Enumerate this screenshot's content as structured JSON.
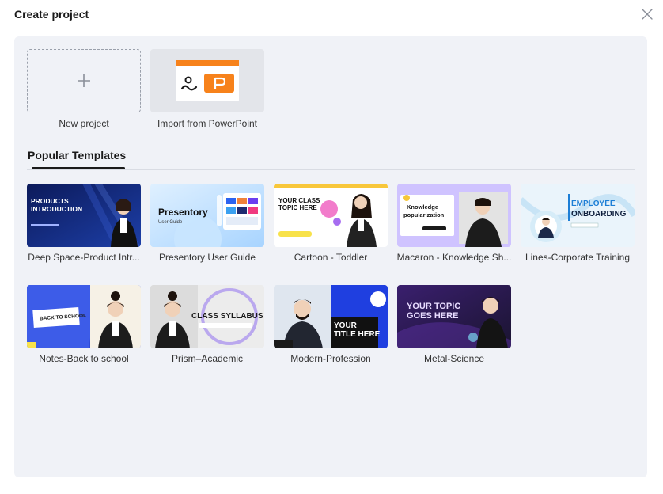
{
  "dialog": {
    "title": "Create project",
    "close_icon": "close-icon"
  },
  "actions": {
    "new_project": "New project",
    "import_ppt": "Import from PowerPoint"
  },
  "section": {
    "title": "Popular Templates"
  },
  "colors": {
    "panel": "#f0f2f7",
    "ppt_orange": "#f7821b"
  },
  "templates": [
    {
      "name": "Deep Space-Product Intr...",
      "thumb_text": [
        "PRODUCTS",
        "INTRODUCTION"
      ]
    },
    {
      "name": "Presentory User Guide",
      "thumb_text": [
        "Presentory",
        "User Guide"
      ]
    },
    {
      "name": "Cartoon - Toddler",
      "thumb_text": [
        "YOUR CLASS",
        "TOPIC HERE"
      ]
    },
    {
      "name": "Macaron - Knowledge Sh...",
      "thumb_text": [
        "Knowledge",
        "popularization"
      ]
    },
    {
      "name": "Lines-Corporate Training",
      "thumb_text": [
        "EMPLOYEE",
        "ONBOARDING"
      ]
    },
    {
      "name": "Notes-Back to school",
      "thumb_text": [
        "BACK TO SCHOOL"
      ]
    },
    {
      "name": "Prism–Academic",
      "thumb_text": [
        "CLASS SYLLABUS"
      ]
    },
    {
      "name": "Modern-Profession",
      "thumb_text": [
        "YOUR",
        "TITLE HERE"
      ]
    },
    {
      "name": "Metal-Science",
      "thumb_text": [
        "YOUR TOPIC",
        "GOES HERE"
      ]
    }
  ]
}
